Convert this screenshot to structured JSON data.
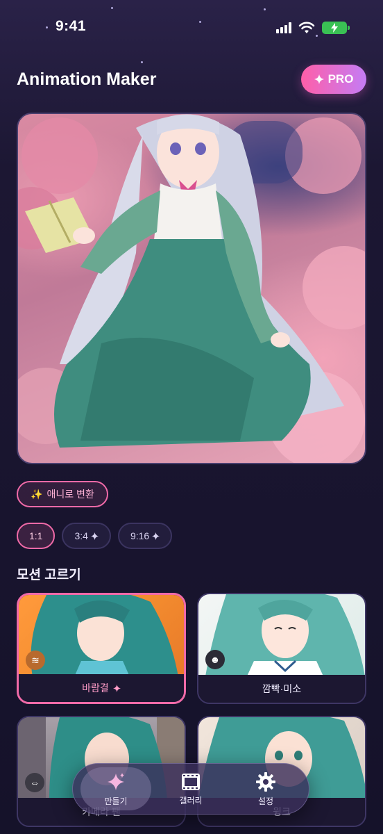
{
  "status_bar": {
    "time": "9:41"
  },
  "header": {
    "title": "Animation Maker",
    "pro_label": "PRO",
    "pro_icon": "sparkle-icon"
  },
  "hero": {
    "alt": "anime girl reading book among cherry blossoms"
  },
  "convert_chip": {
    "icon": "✨",
    "label": "애니로 변환"
  },
  "ratios": [
    {
      "label": "1:1",
      "premium": false,
      "selected": true
    },
    {
      "label": "3:4",
      "premium": true,
      "selected": false
    },
    {
      "label": "9:16",
      "premium": true,
      "selected": false
    }
  ],
  "motion_section": {
    "title": "모션 고르기"
  },
  "motions": [
    {
      "label": "바람결",
      "premium": true,
      "selected": true,
      "icon": "wind-icon"
    },
    {
      "label": "깜빡·미소",
      "premium": false,
      "selected": false,
      "icon": "smile-icon"
    },
    {
      "label": "카메라 팬",
      "premium": false,
      "selected": false,
      "icon": "pan-arrows-icon"
    },
    {
      "label": "윙크",
      "premium": false,
      "selected": false,
      "icon": ""
    }
  ],
  "bottom_nav": [
    {
      "label": "만들기",
      "icon": "sparkle-icon",
      "active": true
    },
    {
      "label": "갤러리",
      "icon": "film-icon",
      "active": false
    },
    {
      "label": "설정",
      "icon": "gear-icon",
      "active": false
    }
  ],
  "colors": {
    "accent": "#f06aa8",
    "background": "#15122a",
    "battery": "#3ac154"
  }
}
